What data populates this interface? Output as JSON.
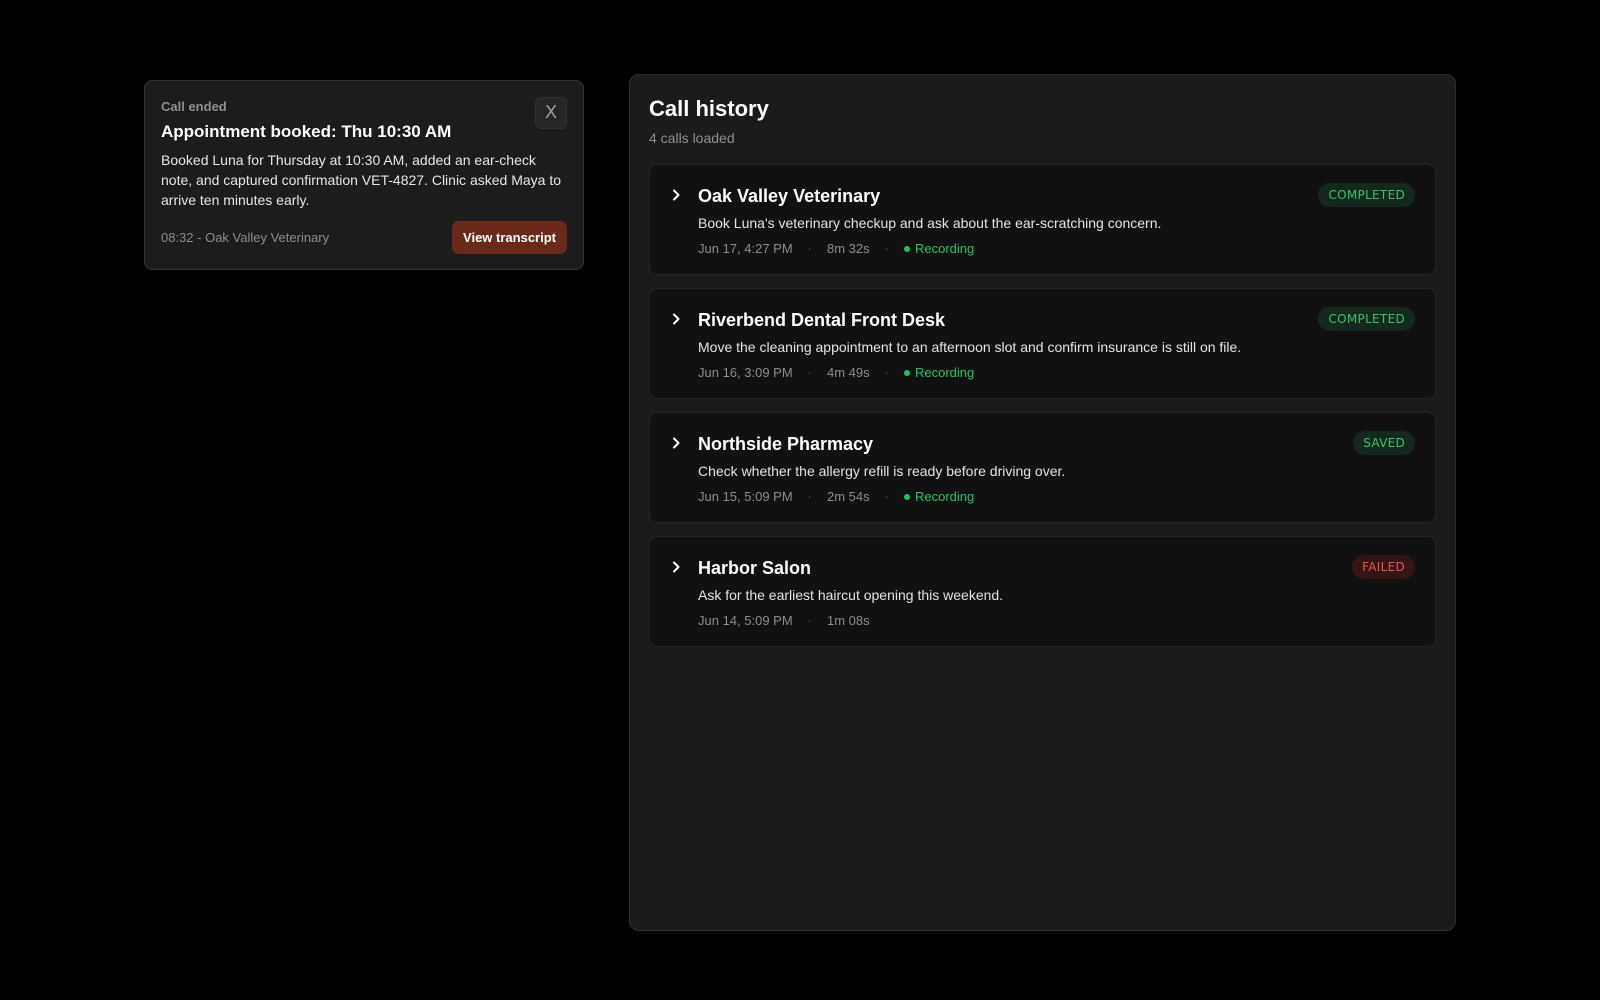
{
  "notification": {
    "eyebrow": "Call ended",
    "title": "Appointment booked: Thu 10:30 AM",
    "body": "Booked Luna for Thursday at 10:30 AM, added an ear-check note, and captured confirmation VET-4827. Clinic asked Maya to arrive ten minutes early.",
    "meta": "08:32 - Oak Valley Veterinary",
    "action_label": "View transcript",
    "close_label": "X",
    "action_color": "#6b2a19"
  },
  "history": {
    "title": "Call history",
    "subtitle": "4 calls loaded",
    "separator": "·",
    "calls": [
      {
        "name": "Oak Valley Veterinary",
        "description": "Book Luna's veterinary checkup and ask about the ear-scratching concern.",
        "timestamp": "Jun 17, 4:27 PM",
        "duration": "8m 32s",
        "recording": "Recording",
        "status": "COMPLETED",
        "status_color": "#36c46a"
      },
      {
        "name": "Riverbend Dental Front Desk",
        "description": "Move the cleaning appointment to an afternoon slot and confirm insurance is still on file.",
        "timestamp": "Jun 16, 3:09 PM",
        "duration": "4m 49s",
        "recording": "Recording",
        "status": "COMPLETED",
        "status_color": "#36c46a"
      },
      {
        "name": "Northside Pharmacy",
        "description": "Check whether the allergy refill is ready before driving over.",
        "timestamp": "Jun 15, 5:09 PM",
        "duration": "2m 54s",
        "recording": "Recording",
        "status": "SAVED",
        "status_color": "#36c46a"
      },
      {
        "name": "Harbor Salon",
        "description": "Ask for the earliest haircut opening this weekend.",
        "timestamp": "Jun 14, 5:09 PM",
        "duration": "1m 08s",
        "recording": null,
        "status": "FAILED",
        "status_color": "#ef5350"
      }
    ]
  }
}
